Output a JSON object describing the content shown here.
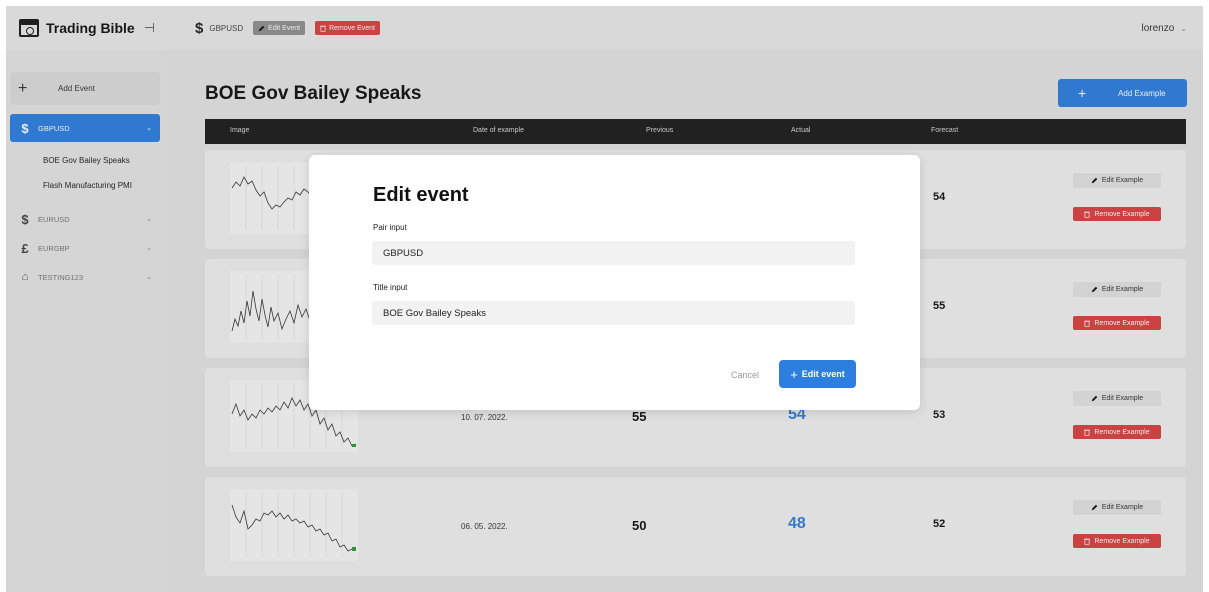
{
  "header": {
    "brand": "Trading Bible",
    "collapse_glyph": "⊣",
    "pair_icon": "$",
    "pair": "GBPUSD",
    "edit_event_label": "Edit Event",
    "remove_event_label": "Remove Event",
    "user": "lorenzo",
    "user_chevron": "⌄"
  },
  "sidebar": {
    "add_label": "Add Event",
    "pairs": [
      {
        "icon": "$",
        "label": "GBPUSD",
        "active": true
      },
      {
        "icon": "$",
        "label": "EURUSD",
        "active": false
      },
      {
        "icon": "£",
        "label": "EURGBP",
        "active": false
      },
      {
        "icon": "⌂",
        "label": "TESTING123",
        "active": false
      }
    ],
    "events": [
      "BOE Gov Bailey Speaks",
      "Flash Manufacturing PMI"
    ]
  },
  "main": {
    "title": "BOE Gov Bailey Speaks",
    "add_example_label": "Add Example",
    "columns": [
      "Image",
      "Date of example",
      "Previous",
      "Actual",
      "Forecast"
    ],
    "rows": [
      {
        "date": "",
        "previous": "",
        "actual": "",
        "forecast": "54"
      },
      {
        "date": "",
        "previous": "",
        "actual": "",
        "forecast": "55"
      },
      {
        "date": "10. 07. 2022.",
        "previous": "55",
        "actual": "54",
        "forecast": "53"
      },
      {
        "date": "06. 05. 2022.",
        "previous": "50",
        "actual": "48",
        "forecast": "52"
      }
    ],
    "edit_example_label": "Edit Example",
    "remove_example_label": "Remove Example"
  },
  "modal": {
    "title": "Edit event",
    "pair_label": "Pair input",
    "pair_value": "GBPUSD",
    "title_label": "Title input",
    "title_value": "BOE Gov Bailey Speaks",
    "cancel_label": "Cancel",
    "submit_label": "Edit event"
  },
  "colors": {
    "accent": "#2c7fdf",
    "danger": "#d94141"
  }
}
